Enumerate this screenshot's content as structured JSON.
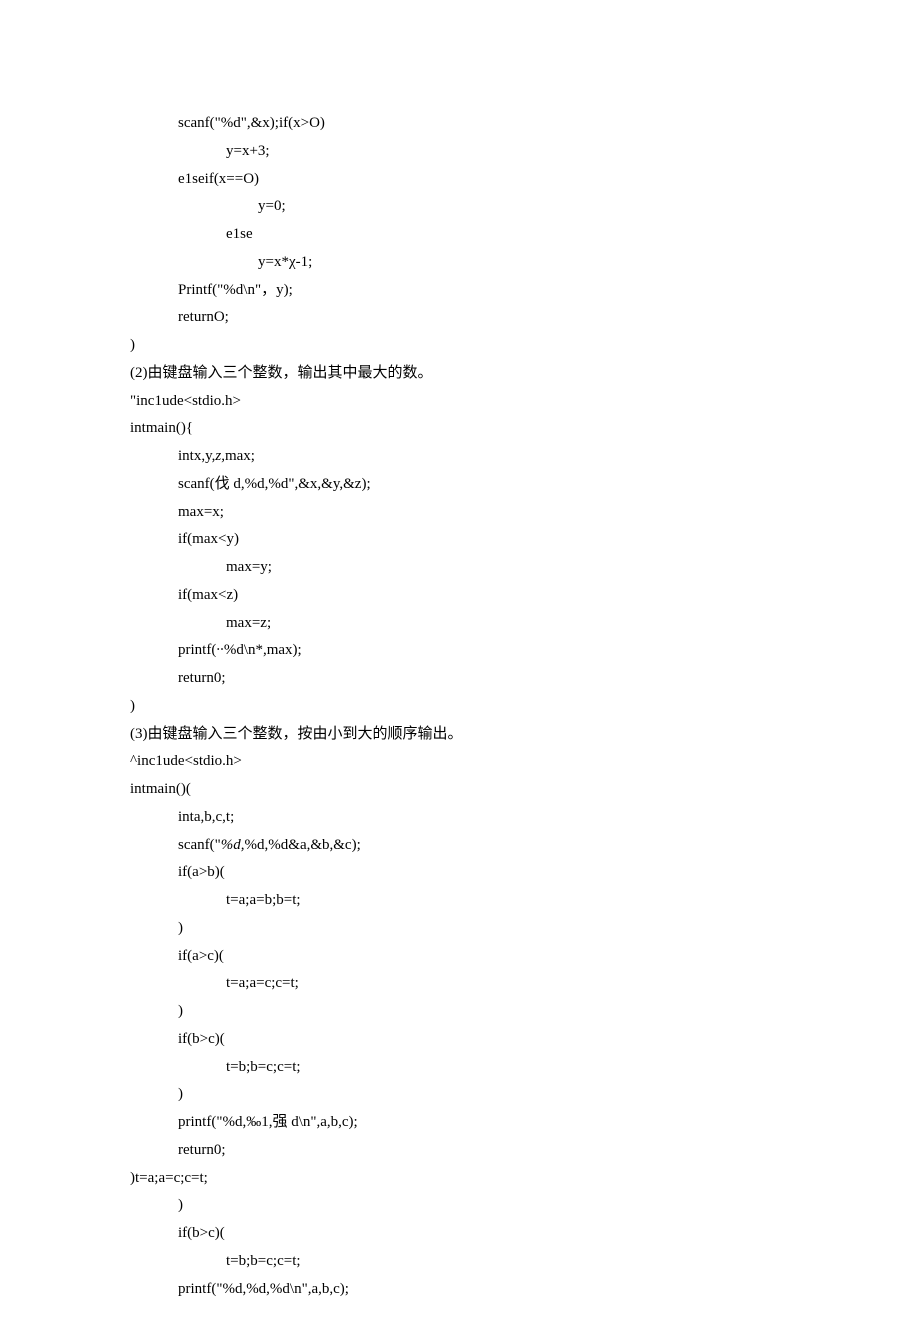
{
  "lines": [
    {
      "indent": 1,
      "text": "scanf(\"%d\",&x);if(x>O)"
    },
    {
      "indent": 2,
      "text": "y=x+3;"
    },
    {
      "indent": 1,
      "text": "e1seif(x==O)"
    },
    {
      "indent": 3,
      "text": "y=0;"
    },
    {
      "indent": 2,
      "text": "e1se"
    },
    {
      "indent": 3,
      "text": "y=x*χ-1;"
    },
    {
      "indent": 1,
      "text": "Printf(\"%d\\n\"，y);"
    },
    {
      "indent": 1,
      "text": "returnO;"
    },
    {
      "indent": 0,
      "text": ")"
    },
    {
      "indent": 0,
      "text": "(2)由键盘输入三个整数，输出其中最大的数。"
    },
    {
      "indent": 0,
      "text": "\"inc1ude<stdio.h>"
    },
    {
      "indent": 0,
      "text": "intmain(){"
    },
    {
      "indent": 1,
      "text": "intx,y,z,max;",
      "italicParts": [
        "z,"
      ]
    },
    {
      "indent": 1,
      "text": "scanf(伐 d,%d,%d\",&x,&y,&z);"
    },
    {
      "indent": 1,
      "text": "max=x;"
    },
    {
      "indent": 1,
      "text": "if(max<y)"
    },
    {
      "indent": 2,
      "text": "max=y;"
    },
    {
      "indent": 1,
      "text": "if(max<z)"
    },
    {
      "indent": 2,
      "text": "max=z;"
    },
    {
      "indent": 1,
      "text": "printf(∙∙%d\\n*,max);"
    },
    {
      "indent": 1,
      "text": "return0;"
    },
    {
      "indent": 0,
      "text": ")"
    },
    {
      "indent": 0,
      "text": "(3)由键盘输入三个整数，按由小到大的顺序输出。"
    },
    {
      "indent": 0,
      "text": "^inc1ude<stdio.h>"
    },
    {
      "indent": 0,
      "text": "intmain()("
    },
    {
      "indent": 1,
      "text": "inta,b,c,t;"
    },
    {
      "indent": 1,
      "text": "scanf(\"%d,%d,%d&a,&b,&c);",
      "italicParts": [
        "%d,"
      ]
    },
    {
      "indent": 1,
      "text": "if(a>b)("
    },
    {
      "indent": 2,
      "text": "t=a;a=b;b=t;"
    },
    {
      "indent": 1,
      "text": ")"
    },
    {
      "indent": 1,
      "text": "if(a>c)("
    },
    {
      "indent": 2,
      "text": "t=a;a=c;c=t;"
    },
    {
      "indent": 1,
      "text": ")"
    },
    {
      "indent": 1,
      "text": "if(b>c)("
    },
    {
      "indent": 2,
      "text": "t=b;b=c;c=t;"
    },
    {
      "indent": 1,
      "text": ")"
    },
    {
      "indent": 1,
      "text": "printf(\"%d,‰1,强 d\\n\",a,b,c);"
    },
    {
      "indent": 1,
      "text": "return0;"
    },
    {
      "indent": 0,
      "text": ")t=a;a=c;c=t;"
    },
    {
      "indent": 1,
      "text": ")"
    },
    {
      "indent": 1,
      "text": "if(b>c)("
    },
    {
      "indent": 2,
      "text": "t=b;b=c;c=t;"
    },
    {
      "indent": 1,
      "text": "printf(\"%d,%d,%d\\n\",a,b,c);"
    }
  ]
}
